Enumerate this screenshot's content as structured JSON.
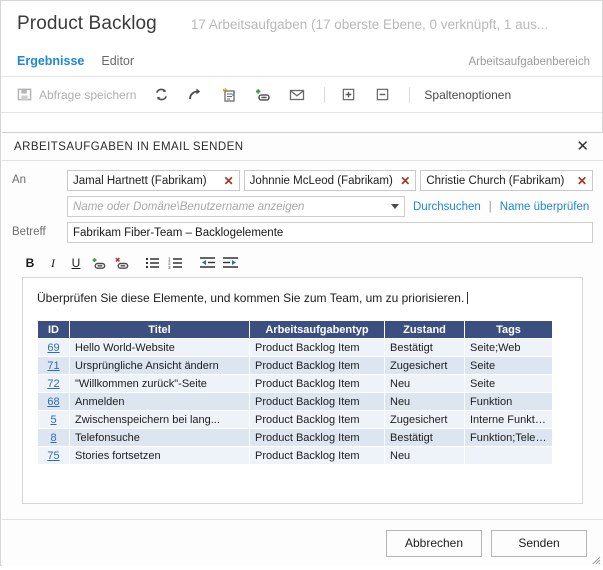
{
  "header": {
    "title": "Product Backlog",
    "count_text": "17 Arbeitsaufgaben (17 oberste Ebene, 0 verknüpft, 1 aus..."
  },
  "tabs": {
    "items": [
      {
        "label": "Ergebnisse",
        "active": true
      },
      {
        "label": "Editor",
        "active": false
      }
    ],
    "right_label": "Arbeitsaufgabenbereich"
  },
  "toolbar": {
    "save_query_label": "Abfrage speichern",
    "column_options_label": "Spaltenoptionen",
    "icons": [
      "save-query-icon",
      "refresh-icon",
      "revert-icon",
      "new-work-item-icon",
      "link-work-item-icon",
      "email-icon",
      "expand-all-icon",
      "collapse-all-icon"
    ]
  },
  "dialog": {
    "title": "ARBEITSAUFGABEN IN EMAIL SENDEN",
    "close_label": "✕",
    "to_label": "An",
    "recipients": [
      "Jamal Hartnett (Fabrikam)",
      "Johnnie McLeod (Fabrikam)",
      "Christie Church (Fabrikam)"
    ],
    "remove_label": "✕",
    "picker_placeholder": "Name oder Domäne\\Benutzername anzeigen",
    "browse_link": "Durchsuchen",
    "link_separator": "|",
    "check_name_link": "Name überprüfen",
    "subject_label": "Betreff",
    "subject_value": "Fabrikam Fiber-Team – Backlogelemente",
    "format_toolbar": [
      {
        "name": "bold-icon",
        "glyph": "B"
      },
      {
        "name": "italic-icon",
        "glyph": "I"
      },
      {
        "name": "underline-icon",
        "glyph": "U"
      },
      {
        "name": "insert-link-icon",
        "glyph": ""
      },
      {
        "name": "remove-link-icon",
        "glyph": ""
      },
      {
        "name": "bulleted-list-icon",
        "glyph": ""
      },
      {
        "name": "numbered-list-icon",
        "glyph": ""
      },
      {
        "name": "outdent-icon",
        "glyph": ""
      },
      {
        "name": "indent-icon",
        "glyph": ""
      }
    ],
    "body_text": "Überprüfen Sie diese Elemente, und kommen Sie zum Team, um zu priorisieren.",
    "table": {
      "columns": [
        "ID",
        "Titel",
        "Arbeitsaufgabentyp",
        "Zustand",
        "Tags"
      ],
      "rows": [
        {
          "id": "69",
          "title": "Hello World-Website",
          "type": "Product Backlog Item",
          "state": "Bestätigt",
          "tags": "Seite;Web"
        },
        {
          "id": "71",
          "title": "Ursprüngliche Ansicht ändern",
          "type": "Product Backlog Item",
          "state": "Zugesichert",
          "tags": "Seite"
        },
        {
          "id": "72",
          "title": "\"Willkommen zurück\"-Seite",
          "type": "Product Backlog Item",
          "state": "Neu",
          "tags": "Seite"
        },
        {
          "id": "68",
          "title": "Anmelden",
          "type": "Product Backlog Item",
          "state": "Neu",
          "tags": "Funktion"
        },
        {
          "id": "5",
          "title": "Zwischenspeichern bei lang...",
          "type": "Product Backlog Item",
          "state": "Zugesichert",
          "tags": "Interne Funktion"
        },
        {
          "id": "8",
          "title": "Telefonsuche",
          "type": "Product Backlog Item",
          "state": "Bestätigt",
          "tags": "Funktion;Telefon"
        },
        {
          "id": "75",
          "title": "Stories fortsetzen",
          "type": "Product Backlog Item",
          "state": "Neu",
          "tags": ""
        }
      ]
    },
    "cancel_label": "Abbrechen",
    "send_label": "Senden"
  },
  "colors": {
    "accent_link": "#1e88d3",
    "table_header": "#3b5080",
    "row_odd": "#eef2f9",
    "row_even": "#dce5f0",
    "remove_x": "#a93226"
  }
}
